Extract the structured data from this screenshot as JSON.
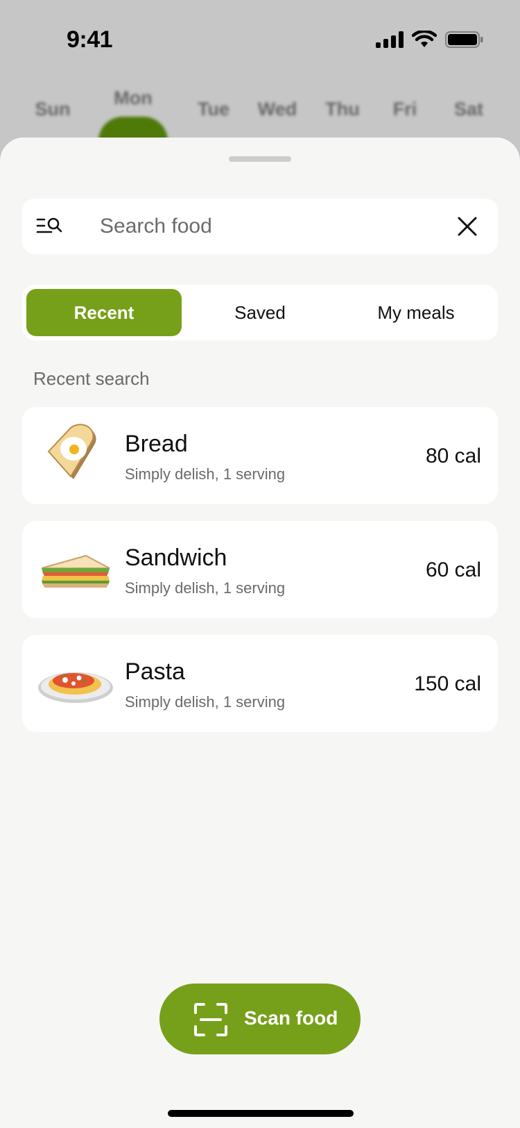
{
  "status_bar": {
    "time": "9:41"
  },
  "days": [
    "Sun",
    "Mon",
    "Tue",
    "Wed",
    "Thu",
    "Fri",
    "Sat"
  ],
  "selected_day": "Mon",
  "search": {
    "placeholder": "Search food",
    "value": ""
  },
  "tabs": [
    {
      "label": "Recent",
      "active": true
    },
    {
      "label": "Saved",
      "active": false
    },
    {
      "label": "My meals",
      "active": false
    }
  ],
  "section_label": "Recent search",
  "foods": [
    {
      "name": "Bread",
      "subtitle": "Simply delish, 1 serving",
      "calories": "80 cal",
      "icon": "bread-egg-icon"
    },
    {
      "name": "Sandwich",
      "subtitle": "Simply delish, 1 serving",
      "calories": "60 cal",
      "icon": "sandwich-icon"
    },
    {
      "name": "Pasta",
      "subtitle": "Simply delish, 1 serving",
      "calories": "150 cal",
      "icon": "pasta-icon"
    }
  ],
  "scan_button": {
    "label": "Scan food",
    "icon": "scan-icon"
  },
  "colors": {
    "accent": "#76a01a",
    "accent_dark": "#4f7a0a",
    "sheet_bg": "#f6f6f4",
    "backdrop": "#c6c6c6"
  }
}
